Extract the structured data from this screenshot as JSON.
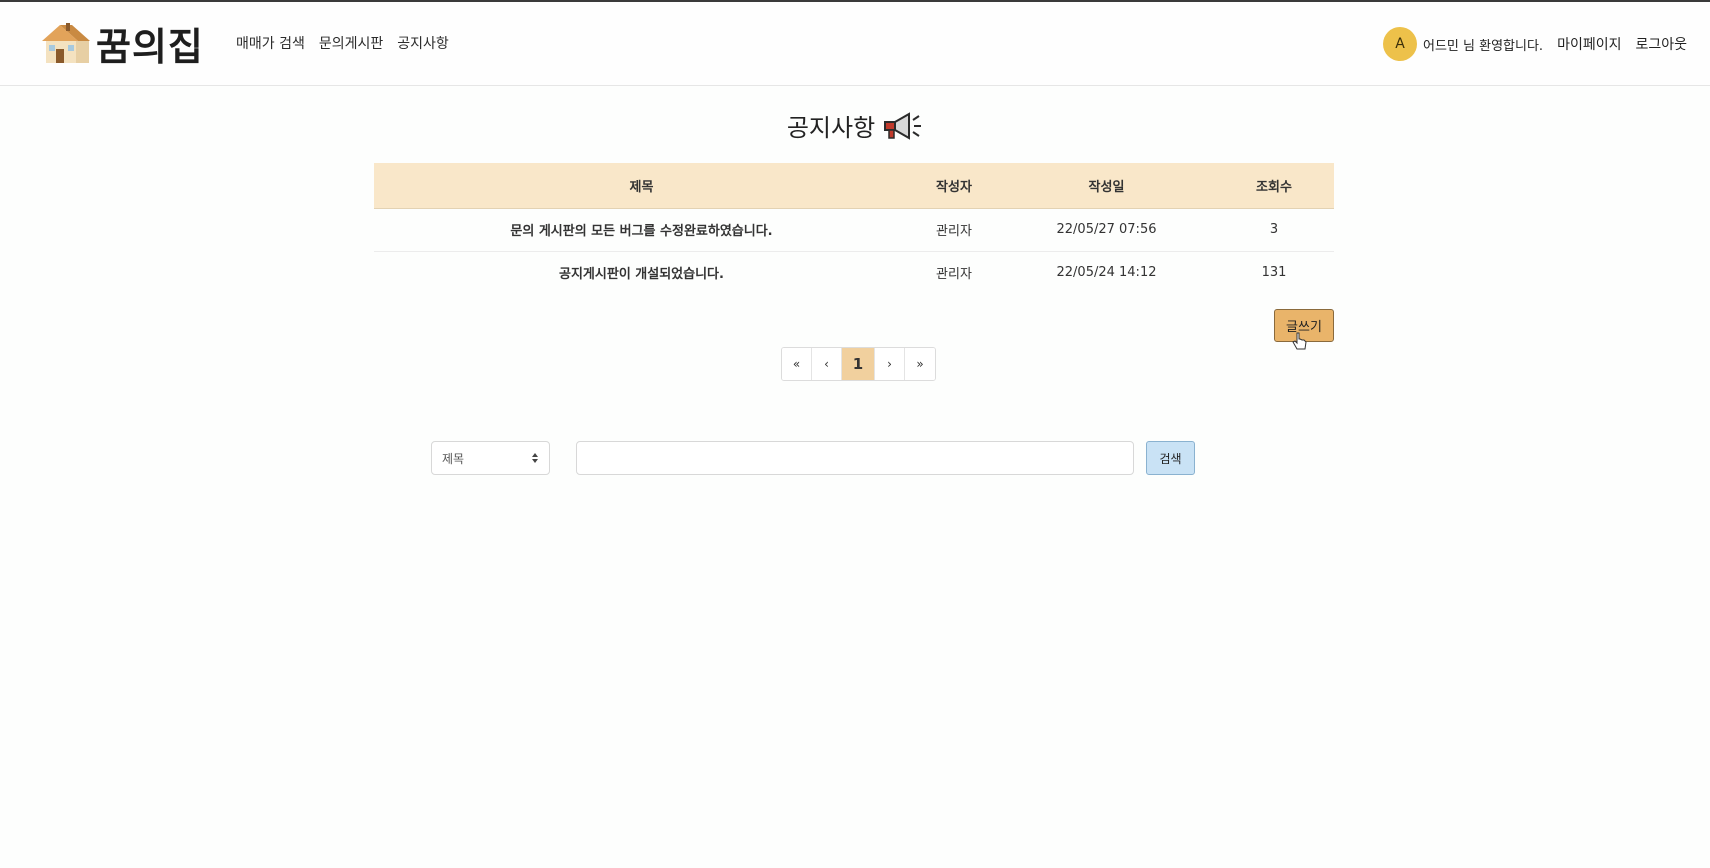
{
  "brand": {
    "name": "꿈의집",
    "logo_icon": "house-logo-icon"
  },
  "nav": {
    "links": [
      "매매가 검색",
      "문의게시판",
      "공지사항"
    ]
  },
  "user": {
    "avatar_letter": "A",
    "welcome": "어드민 님 환영합니다.",
    "mypage": "마이페이지",
    "logout": "로그아웃"
  },
  "page": {
    "title": "공지사항",
    "title_icon": "megaphone-icon"
  },
  "table": {
    "headers": {
      "title": "제목",
      "writer": "작성자",
      "date": "작성일",
      "views": "조회수"
    },
    "rows": [
      {
        "title": "문의 게시판의 모든 버그를 수정완료하였습니다.",
        "writer": "관리자",
        "date": "22/05/27 07:56",
        "views": "3"
      },
      {
        "title": "공지게시판이 개설되었습니다.",
        "writer": "관리자",
        "date": "22/05/24 14:12",
        "views": "131"
      }
    ]
  },
  "write_button": "글쓰기",
  "pagination": {
    "first": "«",
    "prev": "‹",
    "current": "1",
    "next": "›",
    "last": "»"
  },
  "search": {
    "field_selected": "제목",
    "input_value": "",
    "placeholder": "",
    "button": "검색"
  },
  "colors": {
    "header_bg": "#f9e7c9",
    "write_btn": "#e9b46a",
    "active_page": "#f1d09e",
    "search_btn": "#c9e2f5",
    "avatar": "#edc14a"
  }
}
